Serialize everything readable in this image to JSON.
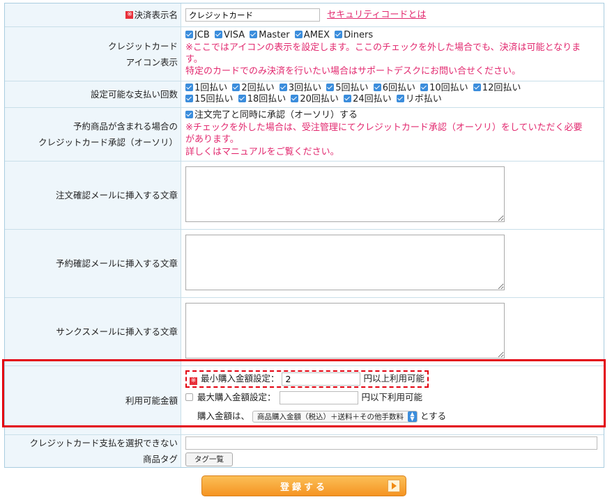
{
  "payment_name": {
    "label": "決済表示名",
    "required_mark": "※",
    "value": "クレジットカード",
    "link": "セキュリティコードとは"
  },
  "card_icons": {
    "label_line1": "クレジットカード",
    "label_line2": "アイコン表示",
    "options": [
      "JCB",
      "VISA",
      "Master",
      "AMEX",
      "Diners"
    ],
    "note1": "※ここではアイコンの表示を設定します。ここのチェックを外した場合でも、決済は可能となりま",
    "note1b": "す。",
    "note2": "特定のカードでのみ決済を行いたい場合はサポートデスクにお問い合せください。"
  },
  "installments": {
    "label": "設定可能な支払い回数",
    "row1": [
      "1回払い",
      "2回払い",
      "3回払い",
      "5回払い",
      "6回払い",
      "10回払い",
      "12回払い"
    ],
    "row2": [
      "15回払い",
      "18回払い",
      "20回払い",
      "24回払い",
      "リボ払い"
    ]
  },
  "reservation": {
    "label_line1": "予約商品が含まれる場合の",
    "label_line2": "クレジットカード承認（オーソリ）",
    "option": "注文完了と同時に承認（オーソリ）する",
    "note1": "※チェックを外した場合は、受注管理にてクレジットカード承認（オーソリ）をしていただく必要",
    "note1b": "があります。",
    "note2": "詳しくはマニュアルをご覧ください。"
  },
  "mail_order": {
    "label": "注文確認メールに挿入する文章"
  },
  "mail_reserve": {
    "label": "予約確認メールに挿入する文章"
  },
  "mail_thanks": {
    "label": "サンクスメールに挿入する文章"
  },
  "amount": {
    "label": "利用可能金額",
    "min_label": "最小購入金額設定：",
    "min_value": "2",
    "min_suffix": "円以上利用可能",
    "min_mark": "※",
    "max_label": "最大購入金額設定：",
    "max_value": "",
    "max_suffix": "円以下利用可能",
    "basis_prefix": "購入金額は、",
    "basis_select": "商品購入金額（税込）＋送料＋その他手数料",
    "basis_suffix": "とする"
  },
  "tags": {
    "label_line1": "クレジットカード支払を選択できない",
    "label_line2": "商品タグ",
    "button": "タグ一覧",
    "value": ""
  },
  "submit_label": "登録する"
}
